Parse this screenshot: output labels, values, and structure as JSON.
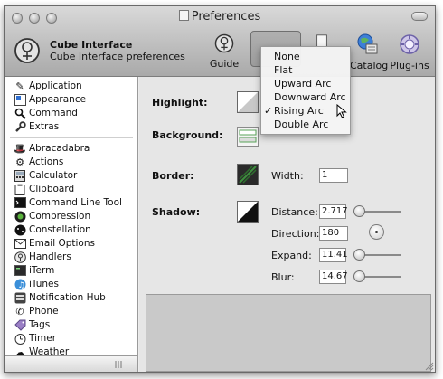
{
  "window": {
    "title": "Preferences"
  },
  "header": {
    "plugin_name": "Cube Interface",
    "plugin_description": "Cube Interface preferences"
  },
  "toolbar": {
    "guide": "Guide",
    "catalog": "Catalog",
    "plugins": "Plug-ins"
  },
  "sidebar": {
    "top_items": [
      {
        "label": "Application",
        "icon": "pencil-icon"
      },
      {
        "label": "Appearance",
        "icon": "appearance-icon"
      },
      {
        "label": "Command",
        "icon": "search-icon"
      },
      {
        "label": "Extras",
        "icon": "wrench-icon"
      }
    ],
    "plugins": [
      {
        "label": "Abracadabra",
        "icon": "magic-icon"
      },
      {
        "label": "Actions",
        "icon": "gear-icon"
      },
      {
        "label": "Calculator",
        "icon": "calculator-icon"
      },
      {
        "label": "Clipboard",
        "icon": "clipboard-icon"
      },
      {
        "label": "Command Line Tool",
        "icon": "terminal-icon"
      },
      {
        "label": "Compression",
        "icon": "compression-icon"
      },
      {
        "label": "Constellation",
        "icon": "constellation-icon"
      },
      {
        "label": "Email Options",
        "icon": "email-icon"
      },
      {
        "label": "Handlers",
        "icon": "handlers-icon"
      },
      {
        "label": "iTerm",
        "icon": "iterm-icon"
      },
      {
        "label": "iTunes",
        "icon": "itunes-icon"
      },
      {
        "label": "Notification Hub",
        "icon": "notification-icon"
      },
      {
        "label": "Phone",
        "icon": "phone-icon"
      },
      {
        "label": "Tags",
        "icon": "tag-icon"
      },
      {
        "label": "Timer",
        "icon": "timer-icon"
      },
      {
        "label": "Weather",
        "icon": "weather-icon"
      }
    ]
  },
  "settings": {
    "highlight_label": "Highlight:",
    "background_label": "Background:",
    "border_label": "Border:",
    "shadow_label": "Shadow:",
    "width_label": "Width:",
    "width_value": "1",
    "distance_label": "Distance:",
    "distance_value": "2.717",
    "distance_level": 0.06,
    "direction_label": "Direction:",
    "direction_value": "180",
    "expand_label": "Expand:",
    "expand_value": "11.41",
    "expand_level": 0.06,
    "blur_label": "Blur:",
    "blur_value": "14.67",
    "blur_level": 0.06
  },
  "highlight_menu": {
    "selected": "Rising Arc",
    "options": [
      "None",
      "Flat",
      "Upward Arc",
      "Downward Arc",
      "Rising Arc",
      "Double Arc"
    ]
  }
}
